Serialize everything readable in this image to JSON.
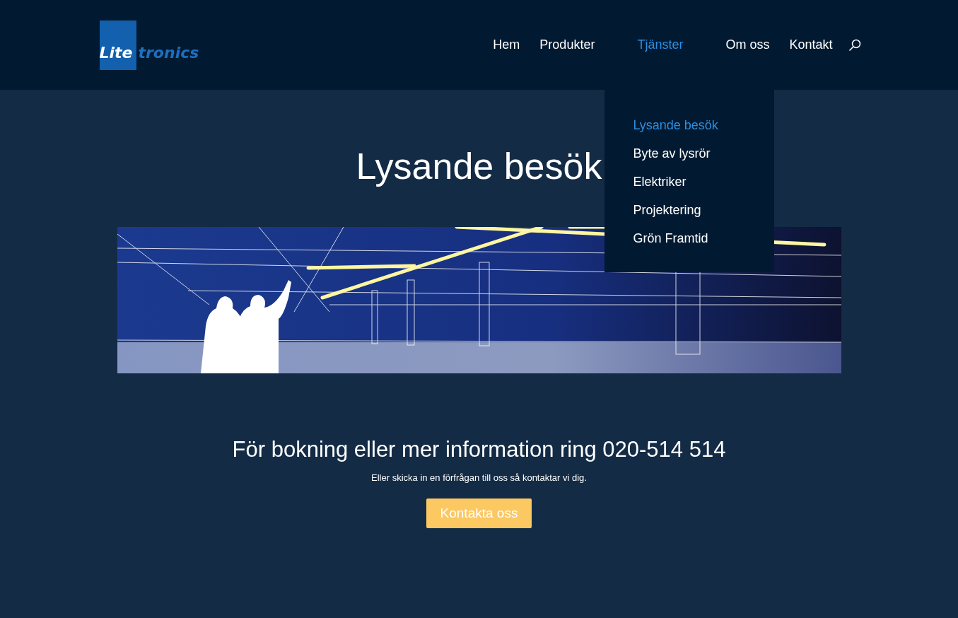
{
  "logo": {
    "block_text": "Lite",
    "text": "tronics"
  },
  "nav": [
    {
      "label": "Hem",
      "selected": false
    },
    {
      "label": "Produkter",
      "selected": false
    },
    {
      "label": "Tjänster",
      "selected": true,
      "expanded": true
    },
    {
      "label": "Om oss",
      "selected": false
    },
    {
      "label": "Kontakt",
      "selected": false
    }
  ],
  "dropdown": [
    {
      "label": "Lysande besök",
      "selected": true
    },
    {
      "label": "Byte av lysrör",
      "selected": false
    },
    {
      "label": "Elektriker",
      "selected": false
    },
    {
      "label": "Projektering",
      "selected": false
    },
    {
      "label": "Grön Framtid",
      "selected": false
    }
  ],
  "title": "Lysande besök",
  "cta": {
    "heading": "För bokning eller mer information ring 020-514 514",
    "text": "Eller skicka in en förfrågan till oss så kontaktar vi dig.",
    "button": "Kontakta oss"
  }
}
